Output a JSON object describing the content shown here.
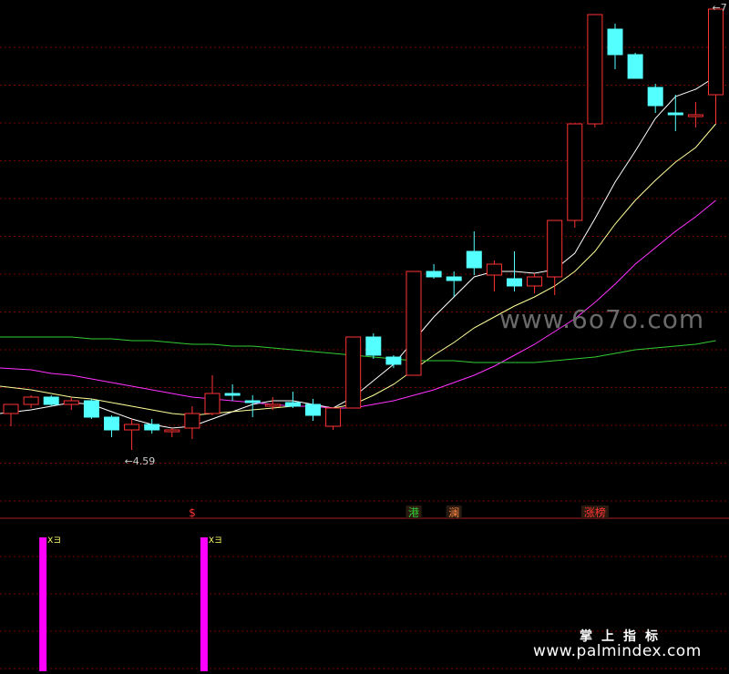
{
  "watermarks": {
    "main": "www.6o7o.com",
    "site_cn": "掌上指标",
    "site_url": "www.palmindex.com"
  },
  "colors": {
    "background": "#000000",
    "grid": "#7a0000",
    "up_candle": "#ff3333",
    "down_candle": "#54ffff",
    "ma_fast": "#ffffff",
    "ma_mid": "#ffff99",
    "ma_slow": "#ff33ff",
    "ma_long": "#33cc33",
    "signal_bar": "#ff00ff",
    "separator": "#aa2222"
  },
  "chart_data": {
    "type": "candlestick",
    "title": "",
    "xlabel": "",
    "ylabel": "",
    "ylim": [
      4.4,
      7.05
    ],
    "candles": [
      {
        "o": 4.83,
        "h": 4.88,
        "l": 4.76,
        "c": 4.88
      },
      {
        "o": 4.88,
        "h": 4.93,
        "l": 4.86,
        "c": 4.92
      },
      {
        "o": 4.92,
        "h": 4.93,
        "l": 4.87,
        "c": 4.88
      },
      {
        "o": 4.88,
        "h": 4.92,
        "l": 4.85,
        "c": 4.9
      },
      {
        "o": 4.9,
        "h": 4.91,
        "l": 4.8,
        "c": 4.81
      },
      {
        "o": 4.81,
        "h": 4.82,
        "l": 4.7,
        "c": 4.74
      },
      {
        "o": 4.74,
        "h": 4.8,
        "l": 4.63,
        "c": 4.77
      },
      {
        "o": 4.77,
        "h": 4.8,
        "l": 4.72,
        "c": 4.74
      },
      {
        "o": 4.73,
        "h": 4.75,
        "l": 4.7,
        "c": 4.74
      },
      {
        "o": 4.75,
        "h": 4.87,
        "l": 4.69,
        "c": 4.83
      },
      {
        "o": 4.83,
        "h": 5.04,
        "l": 4.82,
        "c": 4.94
      },
      {
        "o": 4.94,
        "h": 4.99,
        "l": 4.9,
        "c": 4.93
      },
      {
        "o": 4.9,
        "h": 4.93,
        "l": 4.81,
        "c": 4.89
      },
      {
        "o": 4.87,
        "h": 4.92,
        "l": 4.85,
        "c": 4.88
      },
      {
        "o": 4.89,
        "h": 4.95,
        "l": 4.86,
        "c": 4.87
      },
      {
        "o": 4.88,
        "h": 4.91,
        "l": 4.79,
        "c": 4.82
      },
      {
        "o": 4.76,
        "h": 4.86,
        "l": 4.74,
        "c": 4.86
      },
      {
        "o": 4.86,
        "h": 5.25,
        "l": 4.86,
        "c": 5.25
      },
      {
        "o": 5.25,
        "h": 5.27,
        "l": 5.13,
        "c": 5.15
      },
      {
        "o": 5.14,
        "h": 5.15,
        "l": 5.08,
        "c": 5.1
      },
      {
        "o": 5.04,
        "h": 5.61,
        "l": 5.04,
        "c": 5.61
      },
      {
        "o": 5.61,
        "h": 5.65,
        "l": 5.57,
        "c": 5.58
      },
      {
        "o": 5.58,
        "h": 5.61,
        "l": 5.47,
        "c": 5.56
      },
      {
        "o": 5.72,
        "h": 5.83,
        "l": 5.59,
        "c": 5.63
      },
      {
        "o": 5.59,
        "h": 5.67,
        "l": 5.5,
        "c": 5.65
      },
      {
        "o": 5.57,
        "h": 5.72,
        "l": 5.5,
        "c": 5.53
      },
      {
        "o": 5.53,
        "h": 5.6,
        "l": 5.49,
        "c": 5.58
      },
      {
        "o": 5.58,
        "h": 5.79,
        "l": 5.48,
        "c": 5.89
      },
      {
        "o": 5.89,
        "h": 6.42,
        "l": 5.85,
        "c": 6.42
      },
      {
        "o": 6.42,
        "h": 7.02,
        "l": 6.4,
        "c": 7.02
      },
      {
        "o": 6.94,
        "h": 6.97,
        "l": 6.72,
        "c": 6.8
      },
      {
        "o": 6.8,
        "h": 6.81,
        "l": 6.68,
        "c": 6.67
      },
      {
        "o": 6.62,
        "h": 6.64,
        "l": 6.48,
        "c": 6.52
      },
      {
        "o": 6.48,
        "h": 6.58,
        "l": 6.38,
        "c": 6.47
      },
      {
        "o": 6.47,
        "h": 6.54,
        "l": 6.4,
        "c": 6.47
      },
      {
        "o": 6.58,
        "h": 6.92,
        "l": 6.42,
        "c": 7.05
      }
    ],
    "series": [
      {
        "values": [
          4.83,
          4.85,
          4.87,
          4.89,
          4.88,
          4.84,
          4.8,
          4.77,
          4.75,
          4.76,
          4.8,
          4.84,
          4.88,
          4.9,
          4.9,
          4.88,
          4.86,
          4.92,
          5.01,
          5.1,
          5.23,
          5.36,
          5.47,
          5.58,
          5.61,
          5.61,
          5.6,
          5.62,
          5.71,
          5.9,
          6.1,
          6.27,
          6.45,
          6.57,
          6.61,
          6.68
        ]
      },
      {
        "values": [
          4.98,
          4.96,
          4.94,
          4.92,
          4.91,
          4.89,
          4.87,
          4.85,
          4.83,
          4.82,
          4.83,
          4.84,
          4.85,
          4.86,
          4.87,
          4.87,
          4.86,
          4.88,
          4.93,
          4.99,
          5.07,
          5.15,
          5.22,
          5.3,
          5.36,
          5.42,
          5.47,
          5.53,
          5.61,
          5.72,
          5.87,
          6.0,
          6.11,
          6.21,
          6.29,
          6.42
        ]
      },
      {
        "values": [
          5.08,
          5.07,
          5.05,
          5.04,
          5.02,
          5.0,
          4.98,
          4.96,
          4.94,
          4.92,
          4.91,
          4.9,
          4.89,
          4.88,
          4.87,
          4.87,
          4.86,
          4.86,
          4.88,
          4.9,
          4.93,
          4.96,
          5.0,
          5.04,
          5.09,
          5.15,
          5.21,
          5.28,
          5.35,
          5.44,
          5.54,
          5.65,
          5.74,
          5.83,
          5.91,
          6.0
        ]
      },
      {
        "values": [
          5.25,
          5.25,
          5.25,
          5.25,
          5.24,
          5.24,
          5.23,
          5.23,
          5.22,
          5.21,
          5.21,
          5.2,
          5.2,
          5.19,
          5.18,
          5.17,
          5.16,
          5.15,
          5.14,
          5.13,
          5.12,
          5.12,
          5.12,
          5.11,
          5.11,
          5.11,
          5.11,
          5.12,
          5.13,
          5.14,
          5.16,
          5.18,
          5.19,
          5.2,
          5.21,
          5.23
        ]
      }
    ],
    "annotations": [
      {
        "index": 6,
        "text": "←4.59"
      },
      {
        "index": 35,
        "text": "←7"
      }
    ],
    "markers": [
      {
        "index": 9,
        "text": "$",
        "color": "#ff3333"
      },
      {
        "index": 20,
        "text": "港",
        "color": "#33cc33"
      },
      {
        "index": 22,
        "text": "澜",
        "color": "#ff8844"
      },
      {
        "index": 29,
        "text": "涨榜",
        "color": "#ff3333"
      }
    ],
    "indicator": {
      "bars": [
        {
          "index": 1,
          "value": 1,
          "label": "Xヨ"
        },
        {
          "index": 9,
          "value": 1,
          "label": "Xヨ"
        }
      ]
    }
  }
}
